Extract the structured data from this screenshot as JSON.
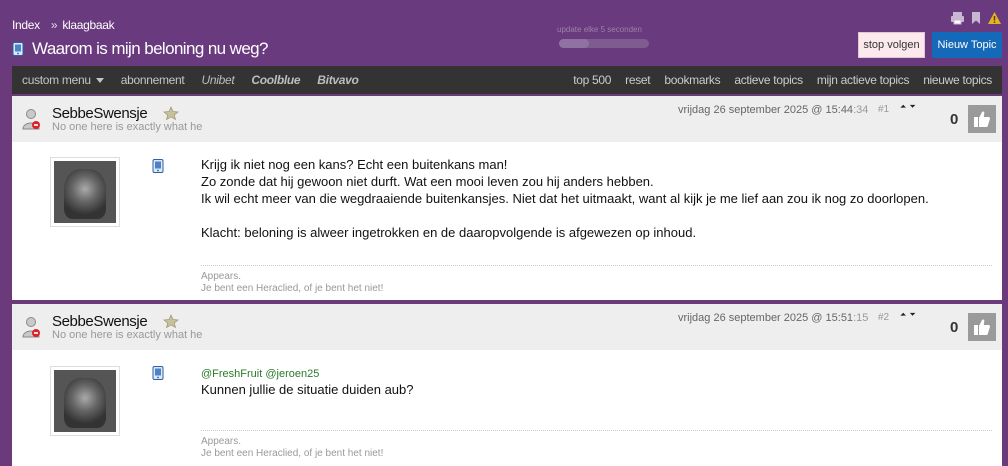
{
  "breadcrumb": {
    "index": "Index",
    "separator": "»",
    "forum": "klaagbaak"
  },
  "topic": {
    "title": "Waarom is mijn beloning nu weg?"
  },
  "update": {
    "label": "update elke 5 seconden",
    "progress": 0.33
  },
  "header": {
    "icons": [
      "print-icon",
      "bookmark-icon",
      "warning-icon"
    ]
  },
  "buttons": {
    "stop_follow": "stop volgen",
    "new_topic": "Nieuw Topic"
  },
  "nav": {
    "custom_menu": "custom menu",
    "subscription": "abonnement",
    "brands": [
      "Unibet",
      "Coolblue",
      "Bitvavo"
    ],
    "right": [
      "top 500",
      "reset",
      "bookmarks",
      "actieve topics",
      "mijn actieve topics",
      "nieuwe topics"
    ]
  },
  "posts": [
    {
      "username": "SebbeSwensje",
      "motto": "No one here is exactly what he",
      "date": "vrijdag 26 september 2025 @ 15:44",
      "date_seconds": ":34",
      "number": "#1",
      "arrows": "⏶⏷",
      "likes": "0",
      "mentions": "",
      "content": [
        "Krijg ik niet nog een kans? Echt een buitenkans man!",
        "Zo zonde dat hij gewoon niet durft. Wat een mooi leven zou hij anders hebben.",
        "Ik wil echt meer van die wegdraaiende buitenkansjes. Niet dat het uitmaakt, want al kijk je me lief aan zou ik nog zo doorlopen.",
        "",
        "Klacht: beloning is alweer ingetrokken en de daaropvolgende is afgewezen op inhoud."
      ],
      "signature": [
        "Appears.",
        "Je bent een Heraclied, of je bent het niet!"
      ]
    },
    {
      "username": "SebbeSwensje",
      "motto": "No one here is exactly what he",
      "date": "vrijdag 26 september 2025 @ 15:51",
      "date_seconds": ":15",
      "number": "#2",
      "arrows": "⏶⏷",
      "likes": "0",
      "mentions": "@FreshFruit @jeroen25",
      "content": [
        "Kunnen jullie de situatie duiden aub?"
      ],
      "signature": [
        "Appears.",
        "Je bent een Heraclied, of je bent het niet!"
      ]
    }
  ]
}
